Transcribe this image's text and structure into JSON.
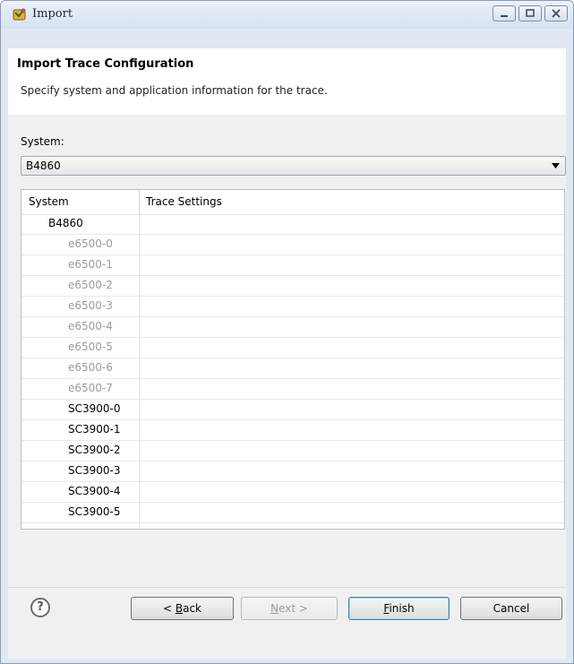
{
  "window": {
    "title": "Import",
    "controls": [
      "minimize-icon",
      "maximize-icon",
      "close-icon"
    ]
  },
  "header": {
    "title": "Import Trace Configuration",
    "description": "Specify system and application information for the trace."
  },
  "system": {
    "label": "System:",
    "selected": "B4860"
  },
  "table": {
    "columns": [
      "System",
      "Trace Settings"
    ],
    "rows": [
      {
        "name": "B4860",
        "enabled": true,
        "indent": 1,
        "settings": ""
      },
      {
        "name": "e6500-0",
        "enabled": false,
        "indent": 2,
        "settings": ""
      },
      {
        "name": "e6500-1",
        "enabled": false,
        "indent": 2,
        "settings": ""
      },
      {
        "name": "e6500-2",
        "enabled": false,
        "indent": 2,
        "settings": ""
      },
      {
        "name": "e6500-3",
        "enabled": false,
        "indent": 2,
        "settings": ""
      },
      {
        "name": "e6500-4",
        "enabled": false,
        "indent": 2,
        "settings": ""
      },
      {
        "name": "e6500-5",
        "enabled": false,
        "indent": 2,
        "settings": ""
      },
      {
        "name": "e6500-6",
        "enabled": false,
        "indent": 2,
        "settings": ""
      },
      {
        "name": "e6500-7",
        "enabled": false,
        "indent": 2,
        "settings": ""
      },
      {
        "name": "SC3900-0",
        "enabled": true,
        "indent": 2,
        "settings": ""
      },
      {
        "name": "SC3900-1",
        "enabled": true,
        "indent": 2,
        "settings": ""
      },
      {
        "name": "SC3900-2",
        "enabled": true,
        "indent": 2,
        "settings": ""
      },
      {
        "name": "SC3900-3",
        "enabled": true,
        "indent": 2,
        "settings": ""
      },
      {
        "name": "SC3900-4",
        "enabled": true,
        "indent": 2,
        "settings": ""
      },
      {
        "name": "SC3900-5",
        "enabled": true,
        "indent": 2,
        "settings": ""
      }
    ]
  },
  "footer": {
    "help_glyph": "?",
    "back": {
      "prefix": "< ",
      "mnemonic": "B",
      "rest": "ack"
    },
    "next": {
      "mnemonic": "N",
      "rest": "ext >"
    },
    "finish": {
      "mnemonic": "F",
      "rest": "inish"
    },
    "cancel": "Cancel"
  }
}
